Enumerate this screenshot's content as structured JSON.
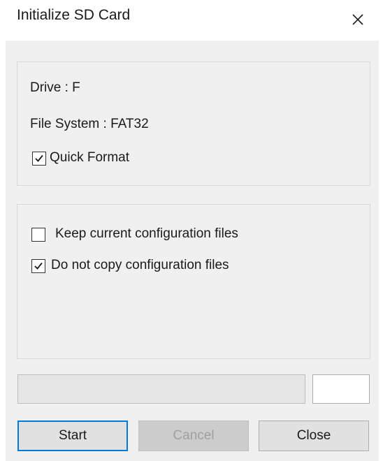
{
  "window": {
    "title": "Initialize SD Card"
  },
  "icons": {
    "close": "close-icon",
    "check": "checkmark-icon"
  },
  "drive_group": {
    "drive_text": "Drive : F",
    "filesystem_text": "File System : FAT32",
    "quick_format": {
      "label": "Quick Format",
      "checked": true
    }
  },
  "config_group": {
    "keep_config": {
      "label": "Keep current configuration files",
      "checked": false
    },
    "no_copy_config": {
      "label": "Do not copy configuration files",
      "checked": true
    }
  },
  "progress": {
    "value": 0,
    "percent_text": ""
  },
  "buttons": {
    "start": "Start",
    "cancel": "Cancel",
    "close": "Close"
  },
  "colors": {
    "default_button_border": "#0078d7",
    "dialog_background": "#f0f0f0",
    "progress_fill": "#06b025"
  }
}
